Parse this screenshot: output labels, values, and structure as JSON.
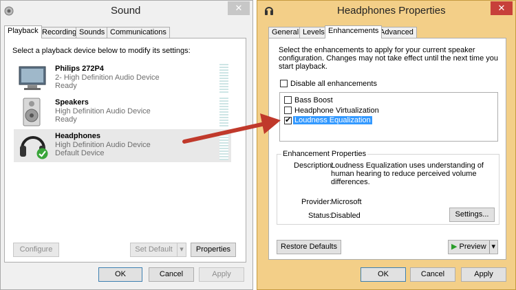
{
  "sound": {
    "title": "Sound",
    "close": "✕",
    "tabs": [
      "Playback",
      "Recording",
      "Sounds",
      "Communications"
    ],
    "instruction": "Select a playback device below to modify its settings:",
    "devices": [
      {
        "name": "Philips 272P4",
        "line2": "2- High Definition Audio Device",
        "line3": "Ready"
      },
      {
        "name": "Speakers",
        "line2": "High Definition Audio Device",
        "line3": "Ready"
      },
      {
        "name": "Headphones",
        "line2": "High Definition Audio Device",
        "line3": "Default Device"
      }
    ],
    "configure": "Configure",
    "set_default": "Set Default",
    "properties": "Properties",
    "ok": "OK",
    "cancel": "Cancel",
    "apply": "Apply"
  },
  "hp": {
    "title": "Headphones Properties",
    "close": "✕",
    "tabs": [
      "General",
      "Levels",
      "Enhancements",
      "Advanced"
    ],
    "instruction": "Select the enhancements to apply for your current speaker configuration. Changes may not take effect until the next time you start playback.",
    "disable_all": "Disable all enhancements",
    "enhancements": [
      {
        "label": "Bass Boost",
        "checked": false
      },
      {
        "label": "Headphone Virtualization",
        "checked": false
      },
      {
        "label": "Loudness Equalization",
        "checked": true
      }
    ],
    "group_title": "Enhancement Properties",
    "description_label": "Description:",
    "description": "Loudness Equalization uses understanding of human hearing to reduce perceived volume differences.",
    "provider_label": "Provider:",
    "provider": "Microsoft",
    "status_label": "Status:",
    "status": "Disabled",
    "settings": "Settings...",
    "restore": "Restore Defaults",
    "preview": "Preview",
    "ok": "OK",
    "cancel": "Cancel",
    "apply": "Apply"
  },
  "colors": {
    "arrow": "#c0392b",
    "selection": "#3399ff",
    "hp_frame": "#f3cf88"
  }
}
